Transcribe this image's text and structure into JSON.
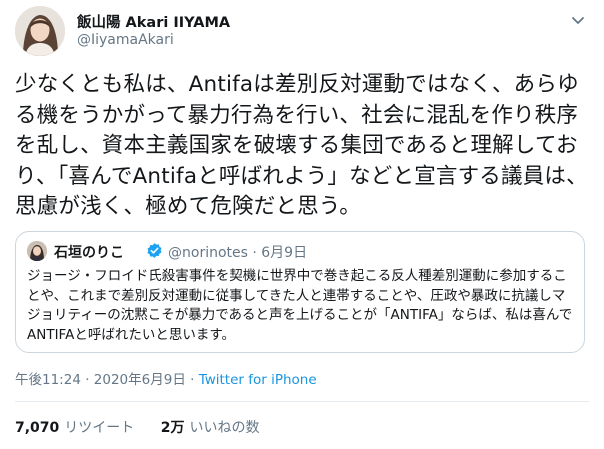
{
  "author": {
    "display_name": "飯山陽 Akari IIYAMA",
    "handle": "@IiyamaAkari"
  },
  "tweet": {
    "text": "少なくとも私は、Antifaは差別反対運動ではなく、あらゆる機をうかがって暴力行為を行い、社会に混乱を作り秩序を乱し、資本主義国家を破壊する集団であると理解しており、「喜んでAntifaと呼ばれよう」などと宣言する議員は、思慮が浅く、極めて危険だと思う。",
    "time": "午後11:24 · 2020年6月9日 · ",
    "source": "Twitter for iPhone"
  },
  "quoted_tweet": {
    "display_name": "石垣のりこ",
    "handle_date": "@norinotes · 6月9日",
    "text": "ジョージ・フロイド氏殺害事件を契機に世界中で巻き起こる反人種差別運動に参加することや、これまで差別反対運動に従事してきた人と連帯することや、圧政や暴政に抗議しマジョリティーの沈黙こそが暴力であると声を上げることが「ANTIFA」ならば、私は喜んでANTIFAと呼ばれたいと思います。"
  },
  "stats": {
    "retweets_count": "7,070",
    "retweets_label": "リツイート",
    "likes_count": "2万",
    "likes_label": "いいねの数"
  },
  "colors": {
    "text": "#14171a",
    "secondary": "#657786",
    "link": "#1b95e0",
    "verified": "#1da1f2",
    "border": "#ccd6dd"
  },
  "icons": {
    "menu": "chevron-down-icon",
    "verified": "verified-badge-icon"
  }
}
